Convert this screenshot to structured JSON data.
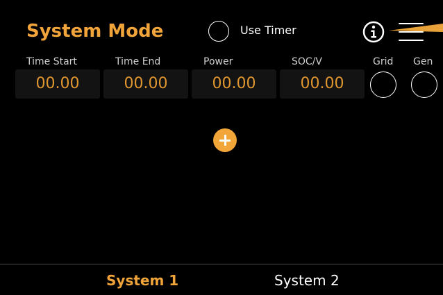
{
  "header": {
    "title": "System Mode",
    "timer_label": "Use Timer",
    "icons": {
      "info": "info-icon",
      "menu": "hamburger-menu-icon"
    }
  },
  "schedule": {
    "columns": [
      "Time Start",
      "Time End",
      "Power",
      "SOC/V",
      "Grid",
      "Gen"
    ],
    "values": [
      "00.00",
      "00.00",
      "00.00",
      "00.00"
    ]
  },
  "tabs": [
    "System 1",
    "System 2"
  ],
  "active_tab": "System 1",
  "colors": {
    "accent": "#f0a43a",
    "value_text": "#e0962e",
    "background": "#000000",
    "cell_background": "#131313"
  }
}
